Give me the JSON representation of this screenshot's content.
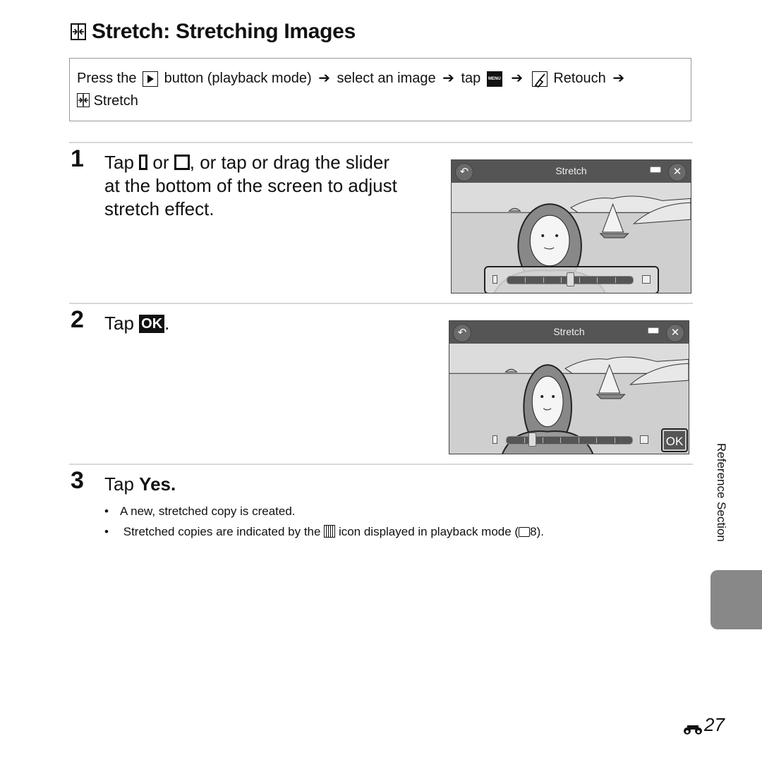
{
  "title": {
    "icon": "stretch-icon",
    "text": "Stretch: Stretching Images"
  },
  "howto": {
    "press_the": "Press the",
    "playback_icon": "playback-button-icon",
    "after_playback": "button (playback mode)",
    "arrow": "➔",
    "select_image": "select an image",
    "tap": "tap",
    "menu_icon_label": "MENU",
    "retouch_label": "Retouch",
    "stretch_label": "Stretch"
  },
  "steps": [
    {
      "number": "1",
      "tap": "Tap",
      "or": "or",
      "rest_line1": ", or tap or drag the slider",
      "line2": "at the bottom of the screen to adjust",
      "line3": "stretch effect."
    },
    {
      "number": "2",
      "tap": "Tap",
      "ok_icon": "OK",
      "suffix": "."
    },
    {
      "number": "3",
      "tap": "Tap",
      "bold": "Yes",
      "suffix": ".",
      "bullets": [
        "A new, stretched copy is created.",
        {
          "before": "Stretched copies are indicated by the",
          "after": "icon displayed in playback mode (",
          "page_ref": "8",
          "close": ")."
        }
      ]
    }
  ],
  "screens": [
    {
      "title": "Stretch",
      "back_icon": "↶",
      "close_icon": "✕",
      "slider_value": 0.5,
      "slider_segments": 7,
      "ok_button": null
    },
    {
      "title": "Stretch",
      "back_icon": "↶",
      "close_icon": "✕",
      "slider_value": 0.2,
      "slider_segments": 7,
      "ok_button": "OK"
    }
  ],
  "side_tab": {
    "label": "Reference Section"
  },
  "page_number": "27"
}
